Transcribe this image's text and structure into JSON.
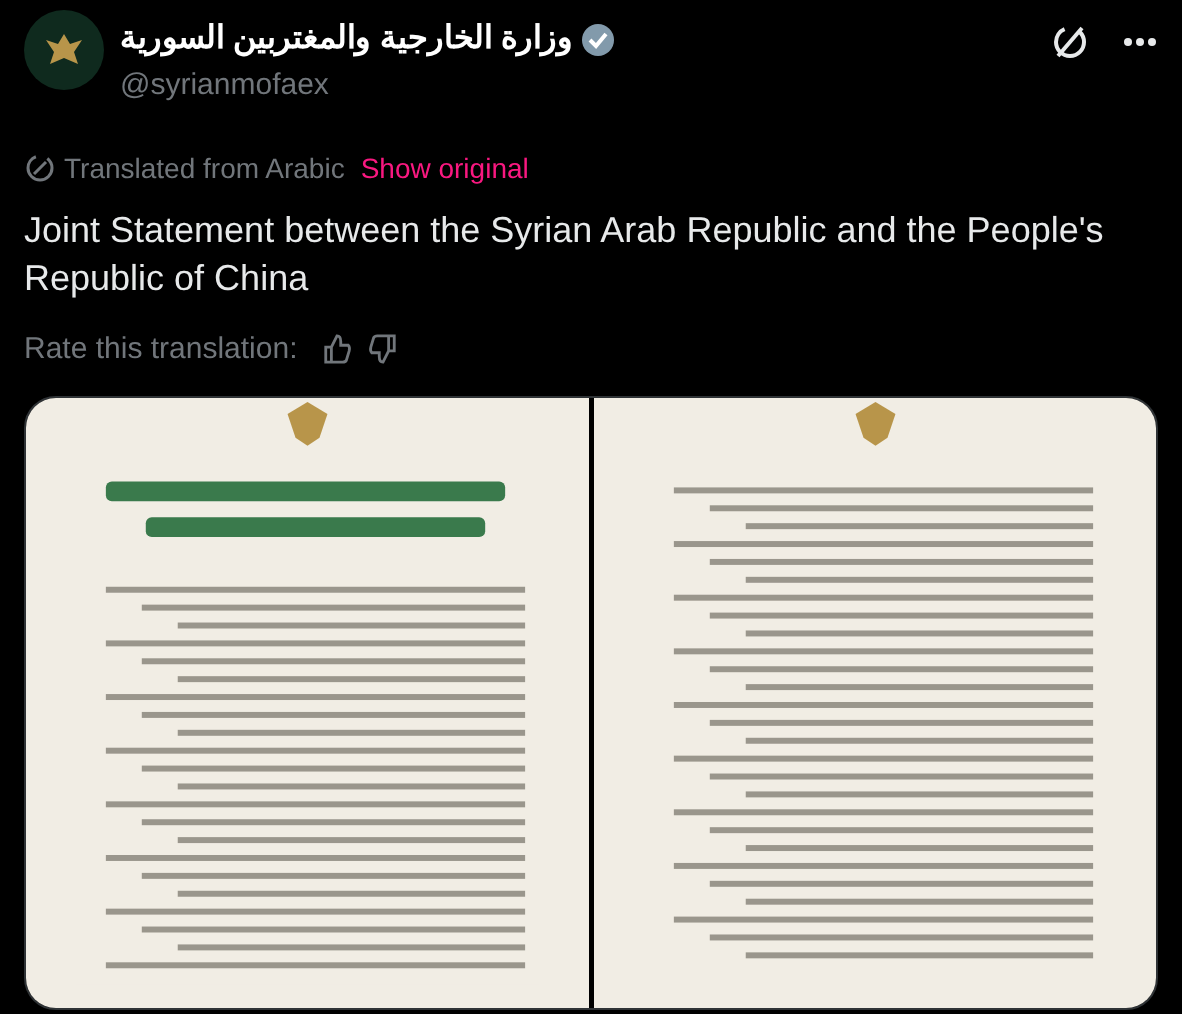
{
  "account": {
    "name": "وزارة الخارجية والمغتربين السورية",
    "verified": true,
    "handle": "@syrianmofaex"
  },
  "translation": {
    "note": "Translated from Arabic",
    "link": "Show original"
  },
  "post_text": "Joint Statement between the Syrian Arab Republic and the People's Republic of China",
  "rate": {
    "label": "Rate this translation:"
  }
}
